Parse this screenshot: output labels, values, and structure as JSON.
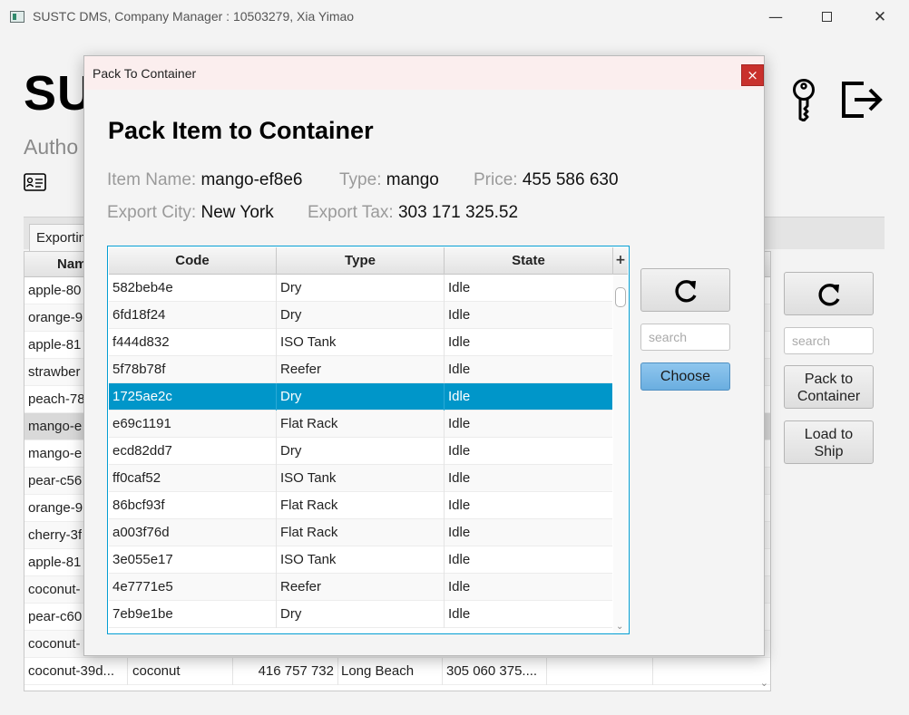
{
  "window": {
    "title": "SUSTC DMS, Company Manager : 10503279, Xia Yimao",
    "minimize": "—",
    "close": "✕"
  },
  "main": {
    "big_title": "SU",
    "author_label": "Autho",
    "tab_label": "Exportin",
    "table": {
      "first_column_header": "Nam",
      "rows": [
        {
          "name": "apple-80"
        },
        {
          "name": "orange-9"
        },
        {
          "name": "apple-81"
        },
        {
          "name": "strawber"
        },
        {
          "name": "peach-78"
        },
        {
          "name": "mango-e"
        },
        {
          "name": "mango-e"
        },
        {
          "name": "pear-c56"
        },
        {
          "name": "orange-9"
        },
        {
          "name": "cherry-3f"
        },
        {
          "name": "apple-81"
        },
        {
          "name": "coconut-"
        },
        {
          "name": "pear-c60"
        },
        {
          "name": "coconut-"
        }
      ],
      "last_row": {
        "name": "coconut-39d...",
        "type": "coconut",
        "price": "416 757 732",
        "city": "Long Beach",
        "tax": "305 060 375...."
      },
      "selected_index": 5
    },
    "search_placeholder": "search",
    "pack_button": [
      "Pack to",
      "Container"
    ],
    "load_button": [
      "Load to",
      "Ship"
    ]
  },
  "dialog": {
    "title": "Pack To Container",
    "close": "×",
    "heading": "Pack Item to Container",
    "item_name_label": "Item Name:",
    "item_name_value": "mango-ef8e6",
    "type_label": "Type:",
    "type_value": "mango",
    "price_label": "Price:",
    "price_value": "455 586 630",
    "export_city_label": "Export City:",
    "export_city_value": "New York",
    "export_tax_label": "Export Tax:",
    "export_tax_value": "303 171 325.52",
    "columns": [
      "Code",
      "Type",
      "State"
    ],
    "column_menu": "+",
    "rows": [
      {
        "code": "582beb4e",
        "type": "Dry",
        "state": "Idle"
      },
      {
        "code": "6fd18f24",
        "type": "Dry",
        "state": "Idle"
      },
      {
        "code": "f444d832",
        "type": "ISO Tank",
        "state": "Idle"
      },
      {
        "code": "5f78b78f",
        "type": "Reefer",
        "state": "Idle"
      },
      {
        "code": "1725ae2c",
        "type": "Dry",
        "state": "Idle"
      },
      {
        "code": "e69c1191",
        "type": "Flat Rack",
        "state": "Idle"
      },
      {
        "code": "ecd82dd7",
        "type": "Dry",
        "state": "Idle"
      },
      {
        "code": "ff0caf52",
        "type": "ISO Tank",
        "state": "Idle"
      },
      {
        "code": "86bcf93f",
        "type": "Flat Rack",
        "state": "Idle"
      },
      {
        "code": "a003f76d",
        "type": "Flat Rack",
        "state": "Idle"
      },
      {
        "code": "3e055e17",
        "type": "ISO Tank",
        "state": "Idle"
      },
      {
        "code": "4e7771e5",
        "type": "Reefer",
        "state": "Idle"
      },
      {
        "code": "7eb9e1be",
        "type": "Dry",
        "state": "Idle"
      }
    ],
    "selected_index": 4,
    "search_placeholder": "search",
    "choose_label": "Choose"
  },
  "icons": {
    "app": "app-icon",
    "id_card": "id-card-icon",
    "key": "key-icon",
    "logout": "logout-icon",
    "refresh": "refresh-icon"
  },
  "colors": {
    "selection": "#0096c9",
    "choose_button": "#7bbbe8",
    "dialog_close": "#c9302c",
    "dialog_titlebar": "#fbeeee"
  }
}
